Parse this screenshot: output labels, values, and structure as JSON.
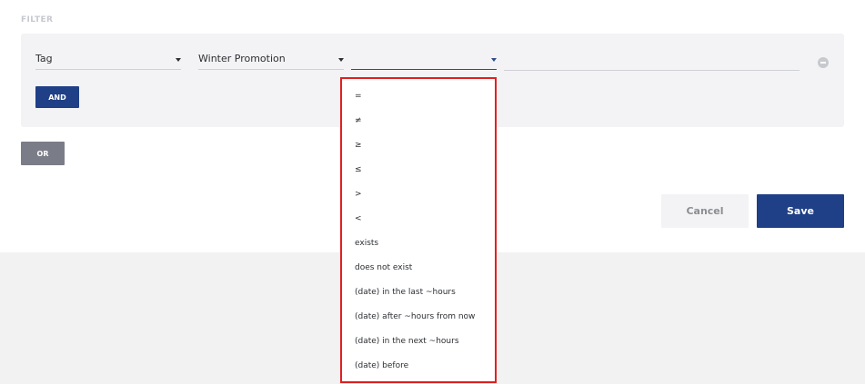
{
  "section_label": "FILTER",
  "filter_row": {
    "field_select": {
      "value": "Tag"
    },
    "tag_select": {
      "value": "Winter Promotion"
    },
    "operator_select": {
      "value": ""
    },
    "value_input": {
      "value": ""
    }
  },
  "buttons": {
    "and_label": "AND",
    "or_label": "OR",
    "cancel_label": "Cancel",
    "save_label": "Save"
  },
  "operator_dropdown": {
    "options": [
      "=",
      "≠",
      "≥",
      "≤",
      ">",
      "<",
      "exists",
      "does not exist",
      "(date) in the last ~hours",
      "(date) after ~hours from now",
      "(date) in the next ~hours",
      "(date) before"
    ]
  },
  "colors": {
    "primary": "#1f3f86",
    "secondary": "#7a7d87",
    "highlight_border": "#e02020",
    "panel_bg": "#f3f3f5"
  },
  "icons": {
    "remove": "minus-circle-icon",
    "caret": "caret-down-icon"
  }
}
